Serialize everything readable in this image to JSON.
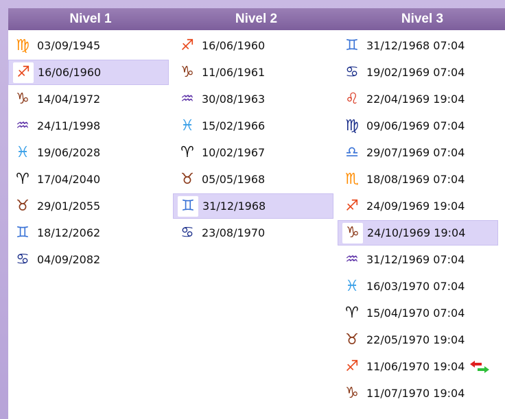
{
  "colors": {
    "earth": "#8b3a1a",
    "fire_orange": "#ff8c00",
    "fire_red": "#e8491d",
    "air": "#5a2ea6",
    "water_light": "#3aa0e8",
    "water_dark": "#1a2e8a",
    "ink": "#111111",
    "air_blue": "#3a73d6",
    "libra": "#3a73d6",
    "virgo": "#1a2e8a",
    "leo": "#d83018",
    "arrow_red": "#e02020",
    "arrow_green": "#2fbf3a"
  },
  "columns": [
    {
      "title": "Nivel 1",
      "rows": [
        {
          "glyph": "♍",
          "icon": "virgo-icon",
          "color": "#ff8c00",
          "text": "03/09/1945",
          "selected": false
        },
        {
          "glyph": "♐",
          "icon": "sagittarius-icon",
          "color": "#e8491d",
          "text": "16/06/1960",
          "selected": true
        },
        {
          "glyph": "♑",
          "icon": "capricorn-icon",
          "color": "#8b3a1a",
          "text": "14/04/1972",
          "selected": false
        },
        {
          "glyph": "♒",
          "icon": "aquarius-icon",
          "color": "#5a2ea6",
          "text": "24/11/1998",
          "selected": false
        },
        {
          "glyph": "♓",
          "icon": "pisces-icon",
          "color": "#3aa0e8",
          "text": "19/06/2028",
          "selected": false
        },
        {
          "glyph": "♈",
          "icon": "aries-icon",
          "color": "#111111",
          "text": "17/04/2040",
          "selected": false
        },
        {
          "glyph": "♉",
          "icon": "taurus-icon",
          "color": "#8b3a1a",
          "text": "29/01/2055",
          "selected": false
        },
        {
          "glyph": "♊",
          "icon": "gemini-icon",
          "color": "#3a73d6",
          "text": "18/12/2062",
          "selected": false
        },
        {
          "glyph": "♋",
          "icon": "cancer-icon",
          "color": "#1a2e8a",
          "text": "04/09/2082",
          "selected": false
        }
      ]
    },
    {
      "title": "Nivel 2",
      "rows": [
        {
          "glyph": "♐",
          "icon": "sagittarius-icon",
          "color": "#e8491d",
          "text": "16/06/1960",
          "selected": false
        },
        {
          "glyph": "♑",
          "icon": "capricorn-icon",
          "color": "#8b3a1a",
          "text": "11/06/1961",
          "selected": false
        },
        {
          "glyph": "♒",
          "icon": "aquarius-icon",
          "color": "#5a2ea6",
          "text": "30/08/1963",
          "selected": false
        },
        {
          "glyph": "♓",
          "icon": "pisces-icon",
          "color": "#3aa0e8",
          "text": "15/02/1966",
          "selected": false
        },
        {
          "glyph": "♈",
          "icon": "aries-icon",
          "color": "#111111",
          "text": "10/02/1967",
          "selected": false
        },
        {
          "glyph": "♉",
          "icon": "taurus-icon",
          "color": "#8b3a1a",
          "text": "05/05/1968",
          "selected": false
        },
        {
          "glyph": "♊",
          "icon": "gemini-icon",
          "color": "#3a73d6",
          "text": "31/12/1968",
          "selected": true
        },
        {
          "glyph": "♋",
          "icon": "cancer-icon",
          "color": "#1a2e8a",
          "text": "23/08/1970",
          "selected": false
        }
      ]
    },
    {
      "title": "Nivel 3",
      "rows": [
        {
          "glyph": "♊",
          "icon": "gemini-icon",
          "color": "#3a73d6",
          "text": "31/12/1968 07:04",
          "selected": false
        },
        {
          "glyph": "♋",
          "icon": "cancer-icon",
          "color": "#1a2e8a",
          "text": "19/02/1969 07:04",
          "selected": false
        },
        {
          "glyph": "♌",
          "icon": "leo-icon",
          "color": "#d83018",
          "text": "22/04/1969 19:04",
          "selected": false
        },
        {
          "glyph": "♍",
          "icon": "virgo-icon",
          "color": "#1a2e8a",
          "text": "09/06/1969 07:04",
          "selected": false
        },
        {
          "glyph": "♎",
          "icon": "libra-icon",
          "color": "#3a73d6",
          "text": "29/07/1969 07:04",
          "selected": false
        },
        {
          "glyph": "♏",
          "icon": "scorpio-icon",
          "color": "#ff8c00",
          "text": "18/08/1969 07:04",
          "selected": false
        },
        {
          "glyph": "♐",
          "icon": "sagittarius-icon",
          "color": "#e8491d",
          "text": "24/09/1969 19:04",
          "selected": false
        },
        {
          "glyph": "♑",
          "icon": "capricorn-icon",
          "color": "#8b3a1a",
          "text": "24/10/1969 19:04",
          "selected": true
        },
        {
          "glyph": "♒",
          "icon": "aquarius-icon",
          "color": "#5a2ea6",
          "text": "31/12/1969 07:04",
          "selected": false
        },
        {
          "glyph": "♓",
          "icon": "pisces-icon",
          "color": "#3aa0e8",
          "text": "16/03/1970 07:04",
          "selected": false
        },
        {
          "glyph": "♈",
          "icon": "aries-icon",
          "color": "#111111",
          "text": "15/04/1970 07:04",
          "selected": false
        },
        {
          "glyph": "♉",
          "icon": "taurus-icon",
          "color": "#8b3a1a",
          "text": "22/05/1970 19:04",
          "selected": false
        },
        {
          "glyph": "♐",
          "icon": "sagittarius-icon",
          "color": "#e8491d",
          "text": "11/06/1970 19:04",
          "selected": false,
          "arrows": true
        },
        {
          "glyph": "♑",
          "icon": "capricorn-icon",
          "color": "#8b3a1a",
          "text": "11/07/1970 19:04",
          "selected": false
        }
      ]
    }
  ]
}
